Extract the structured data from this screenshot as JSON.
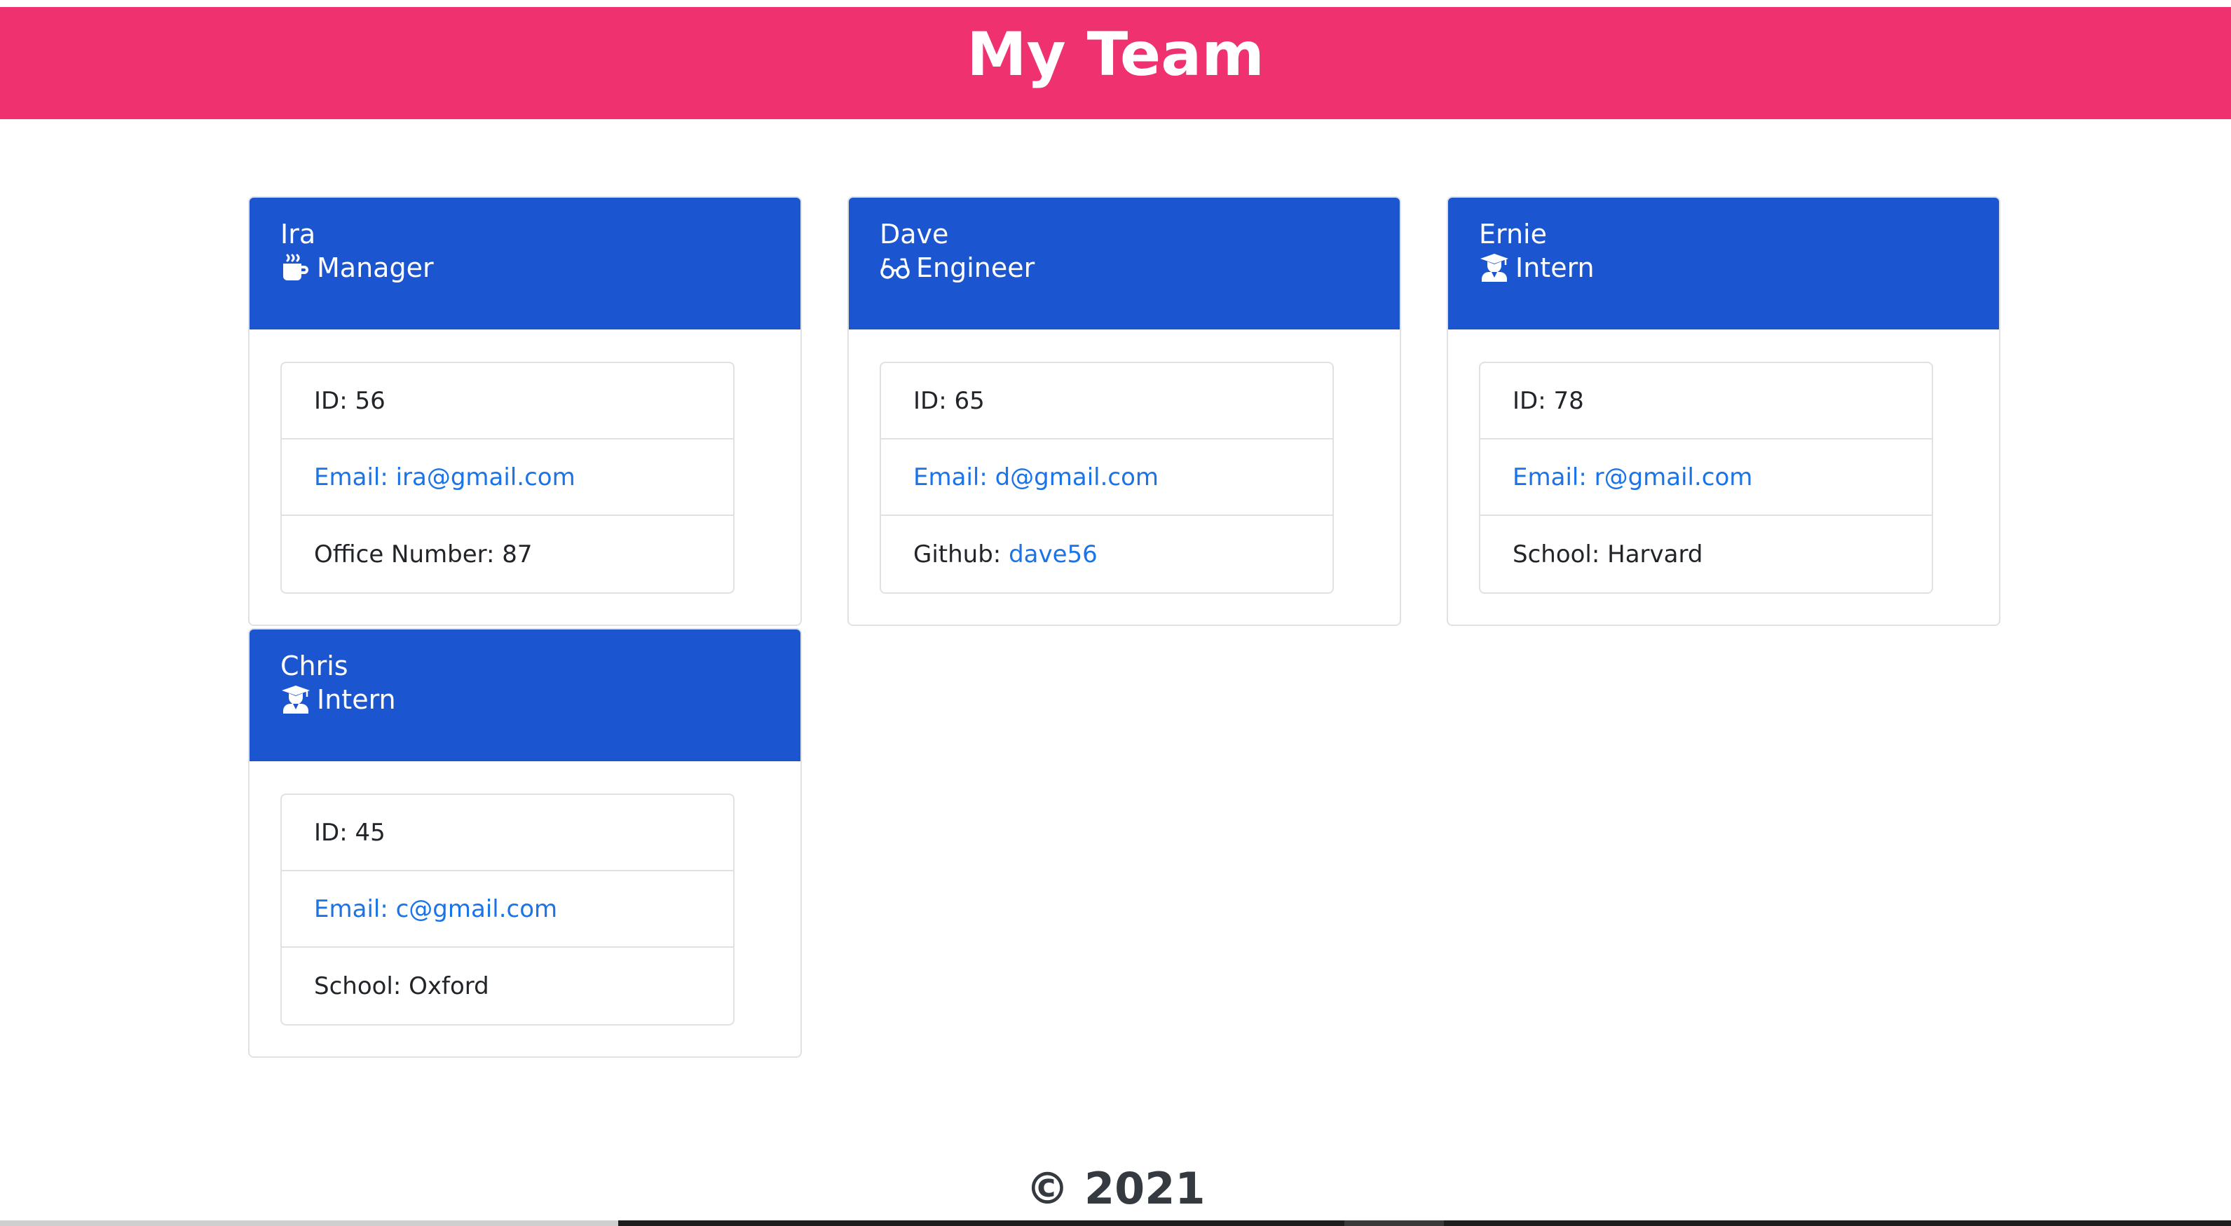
{
  "header": {
    "title": "My Team"
  },
  "members": [
    {
      "name": "Ira",
      "role": "Manager",
      "role_icon": "coffee-mug-icon",
      "id_text": "ID: 56",
      "email_text": "Email: ira@gmail.com",
      "extra_label": "Office Number: 87",
      "extra_link": ""
    },
    {
      "name": "Dave",
      "role": "Engineer",
      "role_icon": "glasses-icon",
      "id_text": "ID: 65",
      "email_text": "Email: d@gmail.com",
      "extra_label": "Github: ",
      "extra_link": "dave56"
    },
    {
      "name": "Ernie",
      "role": "Intern",
      "role_icon": "graduate-icon",
      "id_text": "ID: 78",
      "email_text": "Email: r@gmail.com",
      "extra_label": "School: Harvard",
      "extra_link": ""
    },
    {
      "name": "Chris",
      "role": "Intern",
      "role_icon": "graduate-icon",
      "id_text": "ID: 45",
      "email_text": "Email: c@gmail.com",
      "extra_label": "School: Oxford",
      "extra_link": ""
    }
  ],
  "footer": {
    "text": "© 2021"
  },
  "colors": {
    "banner": "#ef3170",
    "card_header": "#1b56d0",
    "link": "#1a73e8"
  }
}
